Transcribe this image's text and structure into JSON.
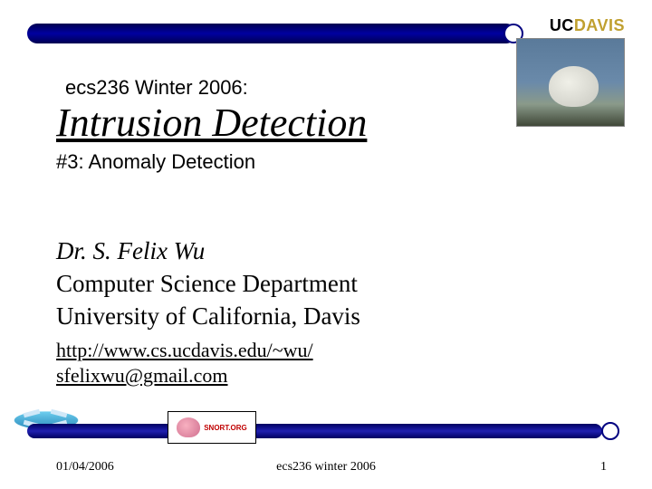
{
  "header": {
    "logo_uc": "UC",
    "logo_davis": "DAVIS"
  },
  "course": {
    "code": "ecs236 Winter 2006:",
    "title": "Intrusion Detection",
    "subtitle": "#3: Anomaly Detection"
  },
  "author": {
    "name": "Dr. S. Felix Wu",
    "dept": "Computer Science Department",
    "univ": "University of California, Davis",
    "url": "http://www.cs.ucdavis.edu/~wu/",
    "email": "sfelixwu@gmail.com"
  },
  "logos": {
    "snort": "SNORT.ORG"
  },
  "footer": {
    "date": "01/04/2006",
    "center": "ecs236 winter 2006",
    "page": "1"
  }
}
